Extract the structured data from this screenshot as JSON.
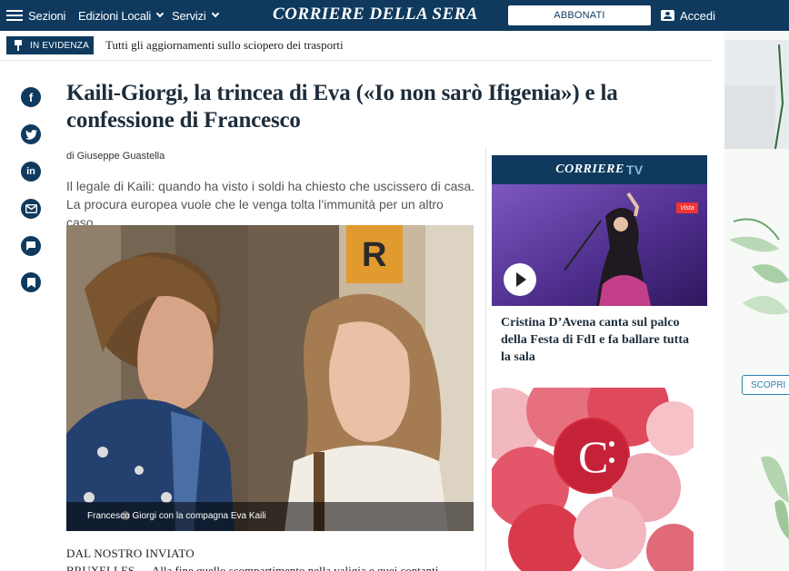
{
  "topbar": {
    "sections_label": "Sezioni",
    "edizioni_label": "Edizioni Locali",
    "servizi_label": "Servizi",
    "logo_text": "CORRIERE DELLA SERA",
    "subscribe_label": "ABBONATI",
    "login_label": "Accedi"
  },
  "evidenza": {
    "badge_label": "IN EVIDENZA",
    "link_text": "Tutti gli aggiornamenti sullo sciopero dei trasporti"
  },
  "share": {
    "icons": [
      "facebook-icon",
      "twitter-icon",
      "linkedin-icon",
      "email-icon",
      "comment-icon",
      "bookmark-icon"
    ]
  },
  "article": {
    "headline": "Kaili-Giorgi, la trincea di Eva («Io non sarò Ifigenia») e la confessione di Francesco",
    "byline": "di Giuseppe Guastella",
    "summary": "Il legale di Kaili: quando ha visto i soldi ha chiesto che uscissero di casa. La procura europea vuole che le venga tolta l’immunità per un altro caso.",
    "photo_caption": "Francesco Giorgi con la compagna Eva Kaili",
    "dateline": "DAL NOSTRO INVIATO",
    "body_start": "BRUXELLES — Alla fine quello scompartimento nella valigia e quei contanti"
  },
  "tv": {
    "header_main": "CORRIERE",
    "header_tv": "TV",
    "badge": "Vista",
    "video_title": "Cristina D’Avena canta sul palco della Festa di FdI e fa ballare tutta la sala"
  },
  "skin": {
    "cta_label": "SCOPRI M"
  },
  "colors": {
    "brand": "#0f3a5e",
    "ad_red": "#d42b3a"
  }
}
